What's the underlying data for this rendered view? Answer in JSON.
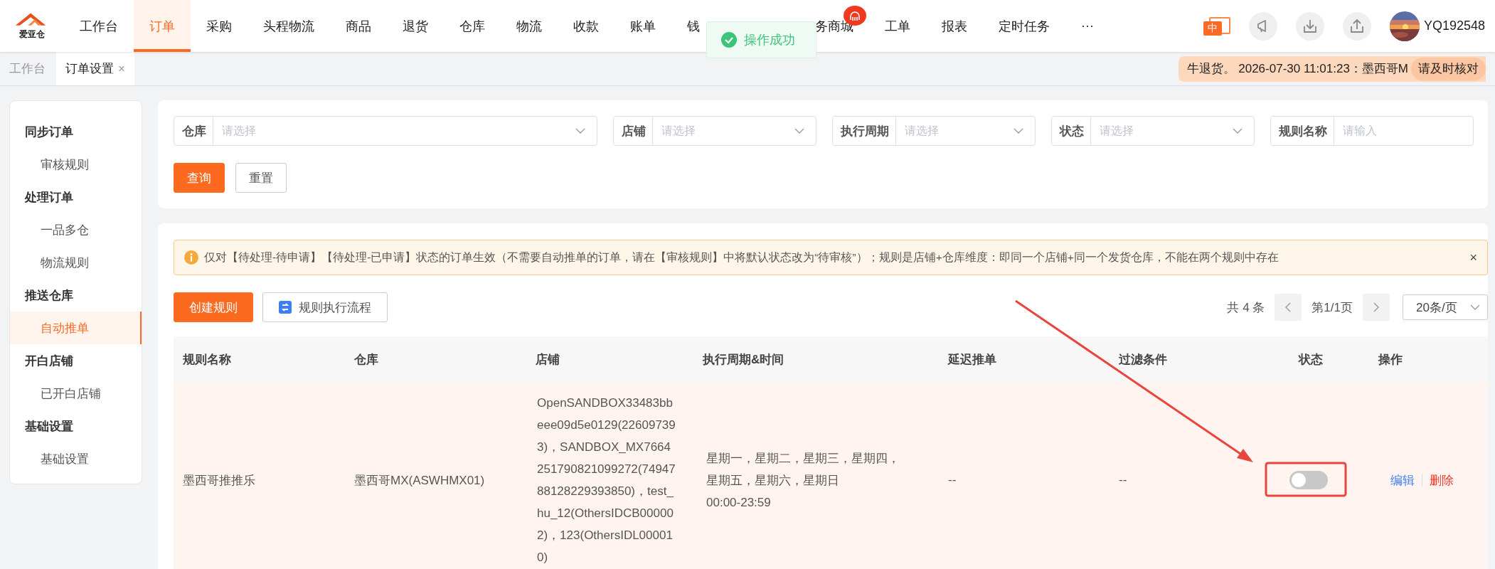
{
  "logo": {
    "text": "爱亚仓"
  },
  "nav": {
    "items": [
      {
        "label": "工作台",
        "selected": false,
        "badge": false
      },
      {
        "label": "订单",
        "selected": true,
        "badge": false
      },
      {
        "label": "采购",
        "selected": false,
        "badge": false
      },
      {
        "label": "头程物流",
        "selected": false,
        "badge": false
      },
      {
        "label": "商品",
        "selected": false,
        "badge": false
      },
      {
        "label": "退货",
        "selected": false,
        "badge": false
      },
      {
        "label": "仓库",
        "selected": false,
        "badge": false
      },
      {
        "label": "物流",
        "selected": false,
        "badge": false
      },
      {
        "label": "收款",
        "selected": false,
        "badge": false
      },
      {
        "label": "账单",
        "selected": false,
        "badge": false
      },
      {
        "label": "钱",
        "selected": false,
        "badge": false
      },
      {
        "label": "务商城",
        "selected": false,
        "badge": true
      },
      {
        "label": "工单",
        "selected": false,
        "badge": false
      },
      {
        "label": "报表",
        "selected": false,
        "badge": false
      },
      {
        "label": "定时任务",
        "selected": false,
        "badge": false
      },
      {
        "label": "···",
        "selected": false,
        "badge": false
      }
    ],
    "lang": "中",
    "user": "YQ192548"
  },
  "toast": {
    "text": "操作成功"
  },
  "tabs": [
    {
      "label": "工作台",
      "selected": false
    },
    {
      "label": "订单设置",
      "selected": true,
      "close": "×"
    }
  ],
  "notice": {
    "text": "牛退货。 2026-07-30 11:01:23：墨西哥M",
    "action": "请及时核对"
  },
  "sidebar": {
    "groups": [
      {
        "title": "同步订单",
        "children": [
          {
            "label": "审核规则",
            "selected": false
          }
        ]
      },
      {
        "title": "处理订单",
        "children": [
          {
            "label": "一品多仓",
            "selected": false
          },
          {
            "label": "物流规则",
            "selected": false
          }
        ]
      },
      {
        "title": "推送仓库",
        "children": [
          {
            "label": "自动推单",
            "selected": true
          }
        ]
      },
      {
        "title": "开白店铺",
        "children": [
          {
            "label": "已开白店铺",
            "selected": false
          }
        ]
      },
      {
        "title": "基础设置",
        "children": [
          {
            "label": "基础设置",
            "selected": false
          }
        ]
      }
    ]
  },
  "filters": [
    {
      "label": "仓库",
      "placeholder": "请选择",
      "kind": "select"
    },
    {
      "label": "店铺",
      "placeholder": "请选择",
      "kind": "select"
    },
    {
      "label": "执行周期",
      "placeholder": "请选择",
      "kind": "select"
    },
    {
      "label": "状态",
      "placeholder": "请选择",
      "kind": "select"
    },
    {
      "label": "规则名称",
      "placeholder": "请输入",
      "kind": "input"
    }
  ],
  "filter_buttons": {
    "query": "查询",
    "reset": "重置"
  },
  "alert": {
    "text": "仅对【待处理-待申请】【待处理-已申请】状态的订单生效（不需要自动推单的订单，请在【审核规则】中将默认状态改为“待审核”）；规则是店铺+仓库维度：即同一个店铺+同一个发货仓库，不能在两个规则中存在",
    "close": "×"
  },
  "toolbar": {
    "create": "创建规则",
    "flow": "规则执行流程"
  },
  "pagination": {
    "total": "共 4 条",
    "page": "第1/1页",
    "page_size": "20条/页"
  },
  "table": {
    "columns": [
      "规则名称",
      "仓库",
      "店铺",
      "执行周期&时间",
      "延迟推单",
      "过滤条件",
      "状态",
      "操作"
    ],
    "rows": [
      {
        "name": "墨西哥推推乐",
        "warehouse": "墨西哥MX(ASWHMX01)",
        "store": "OpenSANDBOX33483bbeee09d5e0129(226097393)，SANDBOX_MX7664251790821099272(7494788128229393850)，test_hu_12(OthersIDCB000002)，123(OthersIDL000010)",
        "schedule_days": "星期一，星期二，星期三，星期四，星期五，星期六，星期日",
        "schedule_time": "00:00-23:59",
        "delay": "--",
        "filter": "--",
        "enabled": false,
        "actions": [
          {
            "label": "编辑",
            "kind": "edit"
          },
          {
            "label": "删除",
            "kind": "delete"
          }
        ]
      }
    ]
  }
}
